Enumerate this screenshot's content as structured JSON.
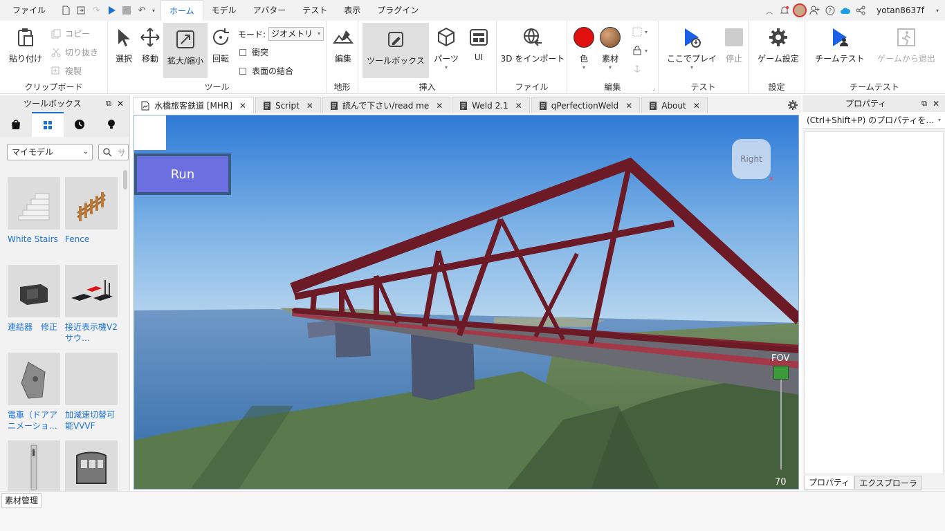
{
  "menubar": {
    "file": "ファイル",
    "tabs": [
      "ホーム",
      "モデル",
      "アバター",
      "テスト",
      "表示",
      "プラグイン"
    ],
    "active_tab": "ホーム",
    "username": "yotan8637f"
  },
  "ribbon": {
    "clipboard": {
      "paste": "貼り付け",
      "copy": "コピー",
      "cut": "切り抜き",
      "duplicate": "複製",
      "label": "クリップボード"
    },
    "tools": {
      "select": "選択",
      "move": "移動",
      "scale": "拡大/縮小",
      "rotate": "回転",
      "mode_label": "モード:",
      "mode_value": "ジオメトリ",
      "collision": "衝突",
      "join_surfaces": "表面の結合",
      "label": "ツール"
    },
    "terrain": {
      "edit": "編集",
      "label": "地形"
    },
    "insert": {
      "toolbox": "ツールボックス",
      "parts": "パーツ",
      "ui": "UI",
      "label": "挿入"
    },
    "file": {
      "import3d": "3D をインポート",
      "label": "ファイル"
    },
    "edit": {
      "color": "色",
      "material": "素材",
      "label": "編集"
    },
    "test": {
      "play_here": "ここでプレイ",
      "stop": "停止",
      "label": "テスト"
    },
    "settings": {
      "game_settings": "ゲーム設定",
      "label": "設定"
    },
    "team_test": {
      "team_test": "チームテスト",
      "exit_game": "ゲームから退出",
      "label": "チームテスト"
    }
  },
  "toolbox": {
    "title": "ツールボックス",
    "category": "マイモデル",
    "search_placeholder": "サ",
    "items": [
      {
        "name": "White Stairs"
      },
      {
        "name": "Fence"
      },
      {
        "name": "連結器　修正"
      },
      {
        "name": "接近表示機V2　サウ…"
      },
      {
        "name": "電車（ドアアニメーショ…"
      },
      {
        "name": "加減速切替可能VVVF"
      },
      {
        "name": ""
      },
      {
        "name": ""
      }
    ]
  },
  "doc_tabs": [
    {
      "label": "水橋旅客鉄道 [MHR]",
      "active": true,
      "icon": "place-icon"
    },
    {
      "label": "Script",
      "active": false,
      "icon": "script-icon"
    },
    {
      "label": "読んで下さい/read me",
      "active": false,
      "icon": "script-icon"
    },
    {
      "label": "Weld 2.1",
      "active": false,
      "icon": "script-icon"
    },
    {
      "label": "qPerfectionWeld",
      "active": false,
      "icon": "script-icon"
    },
    {
      "label": "About",
      "active": false,
      "icon": "script-icon"
    }
  ],
  "viewport": {
    "run_button": "Run",
    "view_cube": "Right",
    "fov_label": "FOV",
    "fov_value": "70"
  },
  "properties": {
    "title": "プロパティ",
    "filter_placeholder": "(Ctrl+Shift+P) のプロパティを…",
    "tab_properties": "プロパティ",
    "tab_explorer": "エクスプローラ"
  },
  "status": {
    "asset_manager": "素材管理"
  },
  "colors": {
    "accent": "#1a6fd6",
    "bridge": "#6b1a26",
    "run_button": "#6b6fe0",
    "color_swatch": "#e01010"
  }
}
